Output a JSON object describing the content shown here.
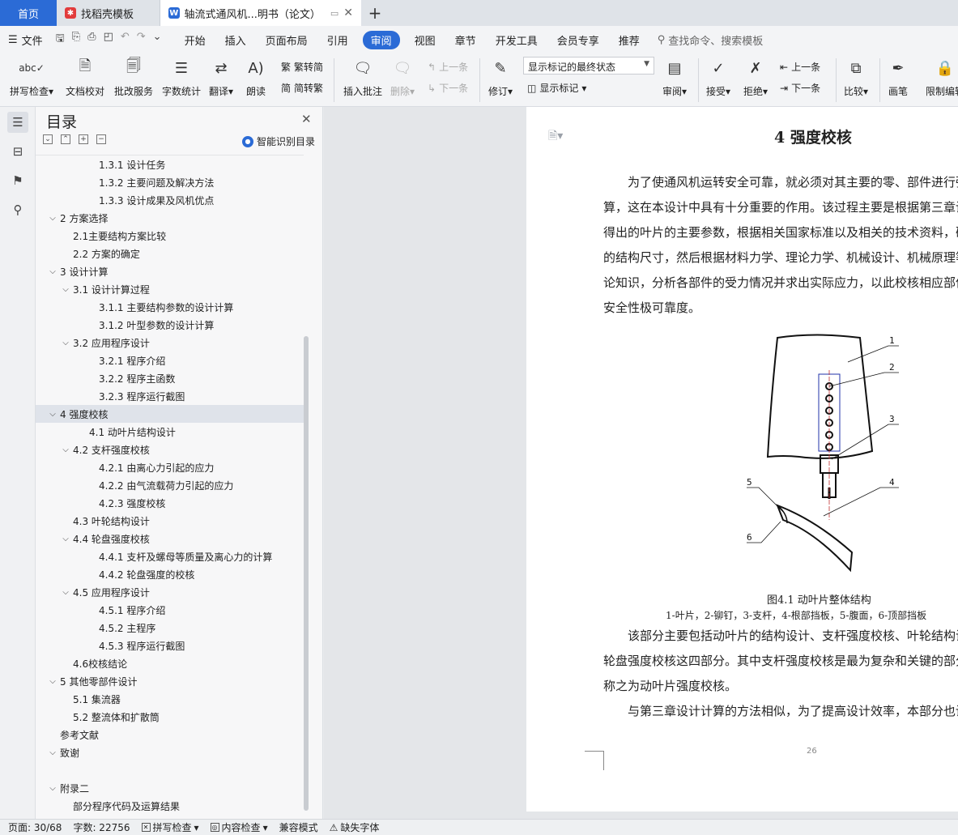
{
  "tabs": {
    "home": "首页",
    "template": "找稻壳模板",
    "document": "轴流式通风机...明书（论文）",
    "new_tab": "+",
    "close": "✕"
  },
  "menu": {
    "file": "文件",
    "items": [
      "开始",
      "插入",
      "页面布局",
      "引用",
      "审阅",
      "视图",
      "章节",
      "开发工具",
      "会员专享",
      "推荐"
    ],
    "active": "审阅",
    "search": "查找命令、搜索模板"
  },
  "ribbon": {
    "spell_icon_text": "abc",
    "spell": "拼写检查",
    "doc_check": "文档校对",
    "revision_service": "批改服务",
    "word_count": "字数统计",
    "translate": "翻译",
    "read_aloud": "朗读",
    "trad_convert": "繁转简",
    "simp_convert": "简转繁",
    "insert_comment": "插入批注",
    "delete": "删除",
    "prev_comment": "上一条",
    "next_comment": "下一条",
    "track_changes": "修订",
    "markup_state": "显示标记的最终状态",
    "show_markup": "显示标记",
    "review": "审阅",
    "accept": "接受",
    "reject": "拒绝",
    "prev_change": "上一条",
    "next_change": "下一条",
    "compare": "比较",
    "ink": "画笔",
    "restrict_edit": "限制编辑"
  },
  "toc": {
    "title": "目录",
    "smart": "智能识别目录",
    "items": [
      {
        "text": "1.3.1  设计任务",
        "level": 3,
        "chev": ""
      },
      {
        "text": "1.3.2  主要问题及解决方法",
        "level": 3,
        "chev": ""
      },
      {
        "text": "1.3.3  设计成果及风机优点",
        "level": 3,
        "chev": ""
      },
      {
        "text": "2  方案选择",
        "level": 1,
        "chev": "⌵"
      },
      {
        "text": "2.1主要结构方案比较",
        "level": 2,
        "chev": ""
      },
      {
        "text": "2.2  方案的确定",
        "level": 2,
        "chev": ""
      },
      {
        "text": "3  设计计算",
        "level": 1,
        "chev": "⌵"
      },
      {
        "text": "3.1  设计计算过程",
        "level": 2,
        "chev": "⌵"
      },
      {
        "text": "3.1.1  主要结构参数的设计计算",
        "level": 3,
        "chev": ""
      },
      {
        "text": "3.1.2  叶型参数的设计计算",
        "level": 3,
        "chev": ""
      },
      {
        "text": "3.2  应用程序设计",
        "level": 2,
        "chev": "⌵"
      },
      {
        "text": "3.2.1  程序介绍",
        "level": 3,
        "chev": ""
      },
      {
        "text": "3.2.2  程序主函数",
        "level": 3,
        "chev": ""
      },
      {
        "text": "3.2.3  程序运行截图",
        "level": 3,
        "chev": ""
      },
      {
        "text": "4  强度校核",
        "level": 1,
        "chev": "⌵",
        "selected": true
      },
      {
        "text": "4.1  动叶片结构设计",
        "level": 2.5,
        "chev": ""
      },
      {
        "text": "4.2  支杆强度校核",
        "level": 2,
        "chev": "⌵"
      },
      {
        "text": "4.2.1  由离心力引起的应力",
        "level": 3,
        "chev": ""
      },
      {
        "text": "4.2.2  由气流载荷力引起的应力",
        "level": 3,
        "chev": ""
      },
      {
        "text": "4.2.3  强度校核",
        "level": 3,
        "chev": ""
      },
      {
        "text": "4.3  叶轮结构设计",
        "level": 2,
        "chev": ""
      },
      {
        "text": "4.4  轮盘强度校核",
        "level": 2,
        "chev": "⌵"
      },
      {
        "text": "4.4.1  支杆及螺母等质量及离心力的计算",
        "level": 3,
        "chev": ""
      },
      {
        "text": "4.4.2  轮盘强度的校核",
        "level": 3,
        "chev": ""
      },
      {
        "text": "4.5  应用程序设计",
        "level": 2,
        "chev": "⌵"
      },
      {
        "text": "4.5.1  程序介绍",
        "level": 3,
        "chev": ""
      },
      {
        "text": "4.5.2  主程序",
        "level": 3,
        "chev": ""
      },
      {
        "text": "4.5.3  程序运行截图",
        "level": 3,
        "chev": ""
      },
      {
        "text": "4.6校核结论",
        "level": 2,
        "chev": ""
      },
      {
        "text": "5  其他零部件设计",
        "level": 1,
        "chev": "⌵"
      },
      {
        "text": "5.1  集流器",
        "level": 2,
        "chev": ""
      },
      {
        "text": "5.2  整流体和扩散筒",
        "level": 2,
        "chev": ""
      },
      {
        "text": "参考文献",
        "level": 1,
        "chev": ""
      },
      {
        "text": "致谢",
        "level": 1,
        "chev": "⌵"
      },
      {
        "text": "",
        "level": 1,
        "chev": ""
      },
      {
        "text": "附录二",
        "level": 1,
        "chev": "⌵"
      },
      {
        "text": "部分程序代码及运算结果",
        "level": 2,
        "chev": ""
      }
    ]
  },
  "document": {
    "chapter_title": "4  强度校核",
    "paragraph1": [
      "　　为了使通风机运转安全可靠，就必须对其主要的零、部件进行强度校核计",
      "算，这在本设计中具有十分重要的作用。该过程主要是根据第三章设计计算中",
      "得出的叶片的主要参数，根据相关国家标准以及相关的技术资料，确定各部件",
      "的结构尺寸，然后根据材料力学、理论力学、机械设计、机械原理等相关的理",
      "论知识，分析各部件的受力情况并求出实际应力，以此校核相应部件的",
      "安全性极可靠度。"
    ],
    "figure_labels": [
      "1",
      "2",
      "3",
      "4",
      "5",
      "6"
    ],
    "figure_caption": "图4.1 动叶片整体结构",
    "figure_legend": "1-叶片，2-铆钉，3-支杆，4-根部挡板，5-腹面，6-顶部挡板",
    "paragraph2": [
      "　　该部分主要包括动叶片的结构设计、支杆强度校核、叶轮结构设计以及",
      "轮盘强度校核这四部分。其中支杆强度校核是最为复杂和关键的部分，也可",
      "称之为动叶片强度校核。",
      "　　与第三章设计计算的方法相似，为了提高设计效率，本部分也设计了"
    ],
    "page_number": "26"
  },
  "status": {
    "page": "页面: 30/68",
    "words": "字数: 22756",
    "spell_check": "拼写检查",
    "content_check": "内容检查",
    "compat_mode": "兼容模式",
    "missing_font": "缺失字体"
  },
  "colors": {
    "accent": "#2b6bd6",
    "selected_row": "#dfe3ea"
  }
}
